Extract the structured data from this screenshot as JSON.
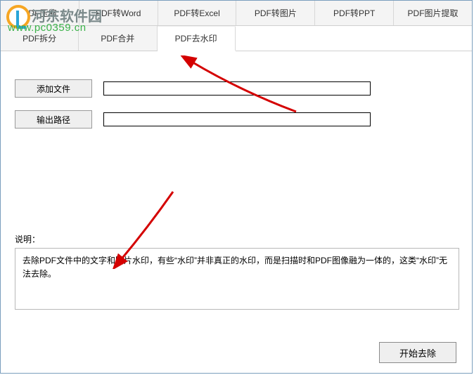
{
  "watermark": {
    "site_name": "河东软件园",
    "site_url": "www.pc0359.cn"
  },
  "tabs_row1": [
    {
      "label": "PDF压缩"
    },
    {
      "label": "PDF转Word"
    },
    {
      "label": "PDF转Excel"
    },
    {
      "label": "PDF转图片"
    },
    {
      "label": "PDF转PPT"
    },
    {
      "label": "PDF图片提取"
    }
  ],
  "tabs_row2": [
    {
      "label": "PDF拆分"
    },
    {
      "label": "PDF合并"
    },
    {
      "label": "PDF去水印",
      "active": true
    }
  ],
  "form": {
    "add_file_button": "添加文件",
    "add_file_value": "",
    "output_path_button": "输出路径",
    "output_path_value": ""
  },
  "description": {
    "label": "说明：",
    "text": "去除PDF文件中的文字和图片水印，有些“水印”并非真正的水印，而是扫描时和PDF图像融为一体的，这类“水印”无法去除。"
  },
  "action": {
    "start_button": "开始去除"
  }
}
